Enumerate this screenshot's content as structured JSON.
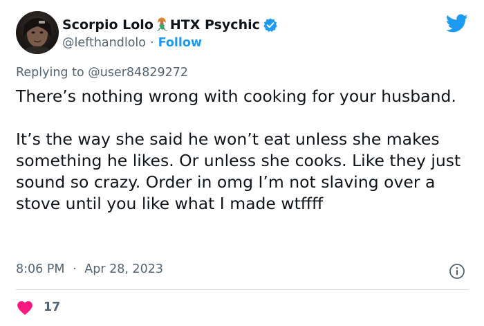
{
  "author": {
    "name_part1": "Scorpio Lolo",
    "name_part2": "HTX Psychic",
    "handle": "@lefthandlolo",
    "separator": "·",
    "follow_label": "Follow"
  },
  "reply": {
    "prefix": "Replying to",
    "target": "@user84829272"
  },
  "tweet": {
    "paragraph1": "There’s nothing wrong with cooking for your husband.",
    "paragraph2": "It’s the way she said he won’t eat unless she makes something he likes. Or unless she cooks. Like they just sound so crazy. Order in omg I’m not slaving over a stove until you like what I made wtffff"
  },
  "meta": {
    "time": "8:06 PM",
    "separator": "·",
    "date": "Apr 28, 2023"
  },
  "engagement": {
    "likes": "17"
  },
  "icons": {
    "brand": "twitter-bird-icon",
    "verified": "verified-badge-icon",
    "name_emoji": "mermaid-emoji",
    "info": "info-icon",
    "like": "heart-icon"
  },
  "colors": {
    "accent": "#1d9bf0",
    "text": "#0f1419",
    "secondary": "#536471",
    "like": "#f91880",
    "divider": "#cfd9de"
  }
}
